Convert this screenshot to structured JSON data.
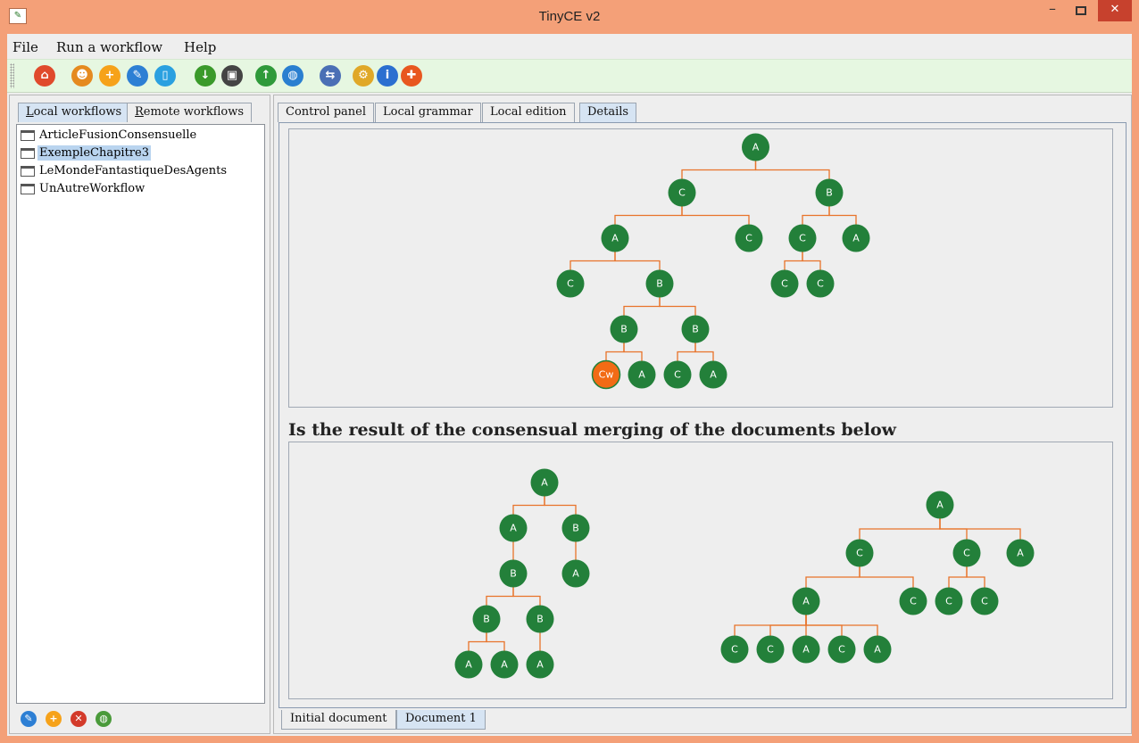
{
  "window": {
    "title": "TinyCE v2",
    "controls": {
      "minimize": "–",
      "maximize": "□",
      "close": "✕"
    }
  },
  "menubar": {
    "items": [
      "File",
      "Run a workflow",
      "Help"
    ]
  },
  "toolbar": {
    "icons": [
      {
        "name": "home-icon",
        "glyph": "⌂",
        "color": "#e04a2c"
      },
      {
        "name": "user-icon",
        "glyph": "☻",
        "color": "#e58a1f"
      },
      {
        "name": "add-icon",
        "glyph": "+",
        "color": "#f6a21a"
      },
      {
        "name": "edit-icon",
        "glyph": "✎",
        "color": "#2d7fd4"
      },
      {
        "name": "trash-icon",
        "glyph": "▯",
        "color": "#2aa0e0"
      },
      {
        "name": "download-icon",
        "glyph": "↓",
        "color": "#3a9a2a"
      },
      {
        "name": "save-icon",
        "glyph": "▣",
        "color": "#444444"
      },
      {
        "name": "upload-icon",
        "glyph": "↑",
        "color": "#2f9a3a"
      },
      {
        "name": "globe-icon",
        "glyph": "◍",
        "color": "#2a7fd0"
      },
      {
        "name": "transfer-icon",
        "glyph": "⇆",
        "color": "#4a6fb5"
      },
      {
        "name": "settings-user-icon",
        "glyph": "⚙",
        "color": "#e0a828"
      },
      {
        "name": "info-icon",
        "glyph": "i",
        "color": "#2b6fd0"
      },
      {
        "name": "help-lifebuoy-icon",
        "glyph": "✚",
        "color": "#e8571f"
      }
    ]
  },
  "left": {
    "tabs": [
      {
        "acc": "L",
        "rest": "ocal workflows"
      },
      {
        "acc": "R",
        "rest": "emote workflows"
      }
    ],
    "workflows": [
      "ArticleFusionConsensuelle",
      "ExempleChapitre3",
      "LeMondeFantastiqueDesAgents",
      "UnAutreWorkflow"
    ],
    "selected_index": 1,
    "bottom_icons": [
      {
        "name": "edit-icon",
        "glyph": "✎",
        "color": "#2d7fd4"
      },
      {
        "name": "add-icon",
        "glyph": "+",
        "color": "#f6a21a"
      },
      {
        "name": "delete-icon",
        "glyph": "✕",
        "color": "#d33a2a"
      },
      {
        "name": "globe-icon",
        "glyph": "◍",
        "color": "#4a9a3a"
      }
    ]
  },
  "right": {
    "tabs": [
      "Control panel",
      "Local grammar",
      "Local edition",
      "Details"
    ],
    "active_tab": "Details",
    "heading": "Is the result of the consensual merging of the documents below",
    "bottom_tabs": [
      "Initial document",
      "Document 1"
    ],
    "active_bottom_tab": "Document 1"
  },
  "colors": {
    "node": "#23803a",
    "highlight_node": "#f26b15",
    "edge": "#e8732a"
  },
  "trees": {
    "merged": {
      "label": "A",
      "children": [
        {
          "label": "C",
          "children": [
            {
              "label": "A",
              "children": [
                {
                  "label": "C"
                },
                {
                  "label": "B",
                  "children": [
                    {
                      "label": "B",
                      "children": [
                        {
                          "label": "Cw",
                          "highlight": true
                        },
                        {
                          "label": "A"
                        }
                      ]
                    },
                    {
                      "label": "B",
                      "children": [
                        {
                          "label": "C"
                        },
                        {
                          "label": "A"
                        }
                      ]
                    }
                  ]
                }
              ]
            },
            {
              "label": "C"
            }
          ]
        },
        {
          "label": "B",
          "children": [
            {
              "label": "C",
              "children": [
                {
                  "label": "C"
                },
                {
                  "label": "C"
                }
              ]
            },
            {
              "label": "A"
            }
          ]
        }
      ]
    },
    "doc_left": {
      "label": "A",
      "children": [
        {
          "label": "A",
          "children": [
            {
              "label": "B",
              "children": [
                {
                  "label": "B",
                  "children": [
                    {
                      "label": "A"
                    },
                    {
                      "label": "A"
                    }
                  ]
                },
                {
                  "label": "B",
                  "children": [
                    {
                      "label": "A"
                    }
                  ]
                }
              ]
            }
          ]
        },
        {
          "label": "B",
          "children": [
            {
              "label": "A"
            }
          ]
        }
      ]
    },
    "doc_right": {
      "label": "A",
      "children": [
        {
          "label": "C",
          "children": [
            {
              "label": "A",
              "children": [
                {
                  "label": "C"
                },
                {
                  "label": "C"
                },
                {
                  "label": "A"
                },
                {
                  "label": "C"
                },
                {
                  "label": "A"
                }
              ]
            },
            {
              "label": "C"
            }
          ]
        },
        {
          "label": "C",
          "children": [
            {
              "label": "C"
            },
            {
              "label": "C"
            }
          ]
        },
        {
          "label": "A"
        }
      ]
    }
  }
}
